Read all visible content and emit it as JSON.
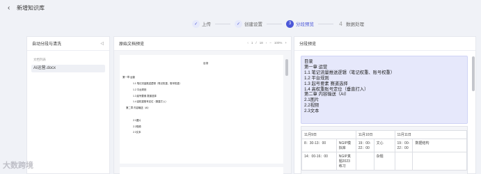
{
  "header": {
    "back_icon": "chevron-left-icon",
    "title": "新增知识库"
  },
  "steps": [
    {
      "label": "上传",
      "state": "done",
      "marker": "✓"
    },
    {
      "label": "创建设置",
      "state": "done",
      "marker": "✓"
    },
    {
      "label": "分段预览",
      "state": "active",
      "marker": "3"
    },
    {
      "label": "数据处理",
      "state": "todo",
      "marker": "4"
    }
  ],
  "left_panel": {
    "title": "自动分段与清洗",
    "collapse_icon": "collapse-left-icon",
    "list_title": "文档列表",
    "documents": [
      "AI运营.docx"
    ]
  },
  "mid_panel": {
    "title": "原始文档预览",
    "pager": {
      "prev": "‹",
      "page": "1",
      "sep": "/",
      "total": "18",
      "next": "›",
      "zoom_out": "−",
      "zoom": "100%",
      "zoom_in": "+"
    },
    "doc": {
      "heading": "目录",
      "lines": [
        "第一章 运营",
        "1.1 笔记流量推送逻辑（笔记权重、账号权重）",
        "1.2 平台规则",
        "1.3 起号要素 赛道选择",
        "1.4 高权重账号定位（垂直打入）",
        "第二章 内容输送（AI）",
        "2.1图片",
        "2.2视频",
        "2.3文本"
      ]
    }
  },
  "right_panel": {
    "title": "分段预览",
    "chunk_lines": [
      "目录",
      "第一章 运营",
      "1.1 笔记流量推送逻辑（笔记权重、账号权重）",
      "1.2 平台规则",
      "1.3 起号要素 赛道选择",
      "1.4 高权重账号定位（垂直打入）",
      "第二章 内容输送（AI）",
      "2.1图片",
      "2.2视频",
      "2.3文本"
    ],
    "schedule": {
      "dates": [
        "11月9日",
        "11月10日",
        "11月11日"
      ],
      "rows": [
        [
          "8：30-13：00",
          "NGIP模拟库",
          "19：00-22：00",
          "文心",
          "19：00-22：00",
          "数据结构"
        ],
        [
          "14：00-16：00",
          "NGIP真题2023练习",
          "",
          "杂题",
          "",
          ""
        ]
      ]
    }
  },
  "watermark": "大数跨境"
}
